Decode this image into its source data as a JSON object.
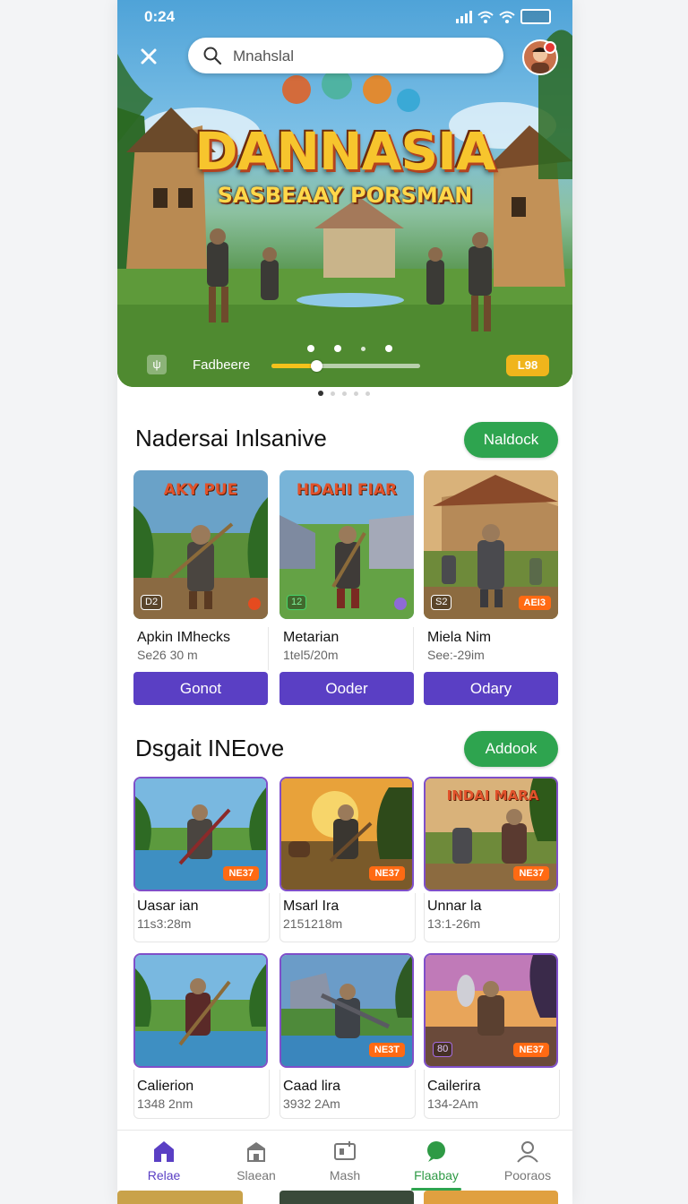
{
  "status_bar": {
    "time": "0:24"
  },
  "search": {
    "placeholder": "Mnahslal"
  },
  "hero": {
    "title": "DANNASIA",
    "subtitle": "SASBEAAY PORSMAN",
    "player_label": "Fadbeere",
    "progress": 0.3,
    "badge": "L98"
  },
  "section1": {
    "title": "Nadersai Inlsanive",
    "add_label": "Naldock",
    "cards": [
      {
        "thumb_title": "AKY PUE",
        "age": "D2",
        "name": "Apkin IMhecks",
        "meta": "Se26 30 m",
        "action": "Gonot"
      },
      {
        "thumb_title": "HDAHI FIAR",
        "age": "12",
        "name": "Metarian",
        "meta": "1tel5/20m",
        "action": "Ooder"
      },
      {
        "thumb_title": "",
        "age": "S2",
        "rating": "AEI3",
        "name": "Miela Nim",
        "meta": "See:-29im",
        "action": "Odary"
      }
    ]
  },
  "section2": {
    "title": "Dsgait INEove",
    "add_label": "Addook",
    "cards": [
      {
        "thumb_title": "",
        "rating": "NE37",
        "name": "Uasar ian",
        "meta": "11s3:28m"
      },
      {
        "thumb_title": "",
        "rating": "NE37",
        "name": "Msarl Ira",
        "meta": "2151218m"
      },
      {
        "thumb_title": "INDAI MARA",
        "rating": "NE37",
        "name": "Unnar la",
        "meta": "13:1-26m"
      },
      {
        "thumb_title": "",
        "rating": "",
        "name": "Calierion",
        "meta": "1348 2nm"
      },
      {
        "thumb_title": "",
        "rating": "NE3T",
        "name": "Caad lira",
        "meta": "3932 2Am"
      },
      {
        "thumb_title": "",
        "age": "80",
        "rating": "NE37",
        "name": "Cailerira",
        "meta": "134-2Am"
      }
    ]
  },
  "nav": {
    "items": [
      {
        "label": "Relae",
        "icon": "house-icon"
      },
      {
        "label": "Slaean",
        "icon": "store-icon"
      },
      {
        "label": "Mash",
        "icon": "tv-icon"
      },
      {
        "label": "Flaabay",
        "icon": "chat-icon"
      },
      {
        "label": "Pooraos",
        "icon": "profile-icon"
      }
    ]
  }
}
